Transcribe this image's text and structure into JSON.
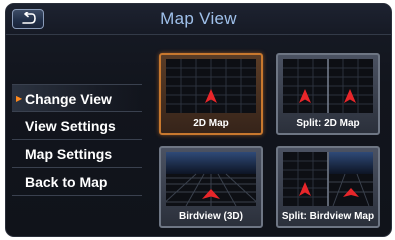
{
  "header": {
    "title": "Map View"
  },
  "menu": {
    "items": [
      {
        "label": "Change View",
        "selected": true
      },
      {
        "label": "View Settings"
      },
      {
        "label": "Map Settings"
      },
      {
        "label": "Back to Map"
      }
    ]
  },
  "tiles": [
    {
      "label": "2D Map",
      "selected": true
    },
    {
      "label": "Split: 2D Map"
    },
    {
      "label": "Birdview (3D)"
    },
    {
      "label": "Split: Birdview Map"
    }
  ],
  "colors": {
    "accent": "#ff8a1e",
    "title_text": "#9fc0ea",
    "position_marker": "#e8262a"
  },
  "icons": {
    "back": "back-arrow-icon",
    "marker": "vehicle-position-icon",
    "selection": "selection-triangle-icon"
  }
}
